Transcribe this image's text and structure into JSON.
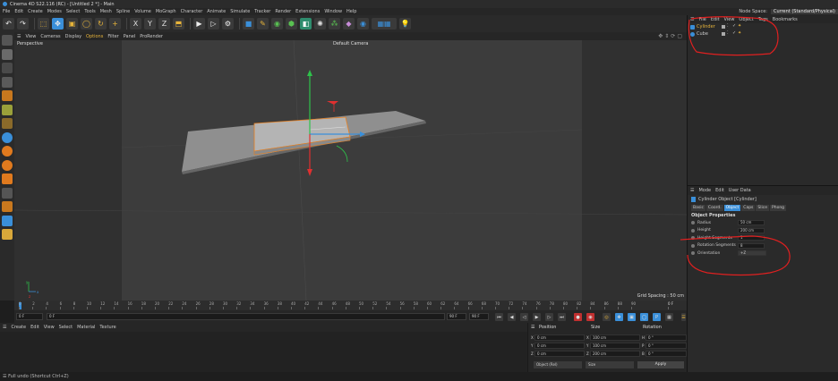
{
  "window": {
    "title": "Cinema 4D S22.116 (RC) - [Untitled 2 *] - Main"
  },
  "menubar": {
    "items": [
      "File",
      "Edit",
      "Create",
      "Modes",
      "Select",
      "Tools",
      "Mesh",
      "Spline",
      "Volume",
      "MoGraph",
      "Character",
      "Animate",
      "Simulate",
      "Tracker",
      "Render",
      "Extensions",
      "Window",
      "Help"
    ],
    "node_space_label": "Node Space:",
    "node_space_value": "Current (Standard/Physical)"
  },
  "viewport": {
    "menu": [
      "View",
      "Cameras",
      "Display",
      "Options",
      "Filter",
      "Panel",
      "ProRender"
    ],
    "projection": "Perspective",
    "camera": "Default Camera",
    "grid_spacing": "Grid Spacing : 50 cm"
  },
  "timeline": {
    "ticks": [
      "0",
      "2",
      "4",
      "6",
      "8",
      "10",
      "12",
      "14",
      "16",
      "18",
      "20",
      "22",
      "24",
      "26",
      "28",
      "30",
      "32",
      "34",
      "36",
      "38",
      "40",
      "42",
      "44",
      "46",
      "48",
      "50",
      "52",
      "54",
      "56",
      "58",
      "60",
      "62",
      "64",
      "66",
      "68",
      "70",
      "72",
      "74",
      "76",
      "78",
      "80",
      "82",
      "84",
      "86",
      "88",
      "90"
    ],
    "current_frame": "0 F",
    "start_frame": "0 F",
    "end_frame": "90 F",
    "end_frame2": "90 F",
    "frame_field": "0 F"
  },
  "material_manager": {
    "menu": [
      "Create",
      "Edit",
      "View",
      "Select",
      "Material",
      "Texture"
    ]
  },
  "coordinates": {
    "headers": [
      "Position",
      "Size",
      "Rotation"
    ],
    "rows": [
      {
        "axis": "X",
        "pos": "0 cm",
        "size_axis": "X",
        "size": "100 cm",
        "rot_axis": "H",
        "rot": "0 °"
      },
      {
        "axis": "Y",
        "pos": "0 cm",
        "size_axis": "Y",
        "size": "100 cm",
        "rot_axis": "P",
        "rot": "0 °"
      },
      {
        "axis": "Z",
        "pos": "0 cm",
        "size_axis": "Z",
        "size": "200 cm",
        "rot_axis": "B",
        "rot": "0 °"
      }
    ],
    "mode_dropdown": "Object (Rel)",
    "size_dropdown": "Size",
    "apply_label": "Apply"
  },
  "object_manager": {
    "menu": [
      "File",
      "Edit",
      "View",
      "Object",
      "Tags",
      "Bookmarks"
    ],
    "objects": [
      {
        "name": "Cylinder",
        "color": "#3a8fd9",
        "selected": true
      },
      {
        "name": "Cube",
        "color": "#3a8fd9",
        "selected": false
      }
    ]
  },
  "attribute_manager": {
    "menu": [
      "Mode",
      "Edit",
      "User Data"
    ],
    "object_label": "Cylinder Object [Cylinder]",
    "tabs": [
      "Basic",
      "Coord.",
      "Object",
      "Caps",
      "Slice",
      "Phong"
    ],
    "active_tab": "Object",
    "section": "Object Properties",
    "properties": [
      {
        "label": "Radius",
        "value": "50 cm"
      },
      {
        "label": "Height",
        "value": "200 cm"
      },
      {
        "label": "Height Segments",
        "value": "1"
      },
      {
        "label": "Rotation Segments",
        "value": "8"
      },
      {
        "label": "Orientation",
        "value": "+Z"
      }
    ]
  },
  "status": {
    "text": "Full undo (Shortcut Ctrl+Z)"
  },
  "colors": {
    "accent": "#3a8fd9",
    "annotation": "#e02020",
    "bg": "#1e1e1e"
  }
}
